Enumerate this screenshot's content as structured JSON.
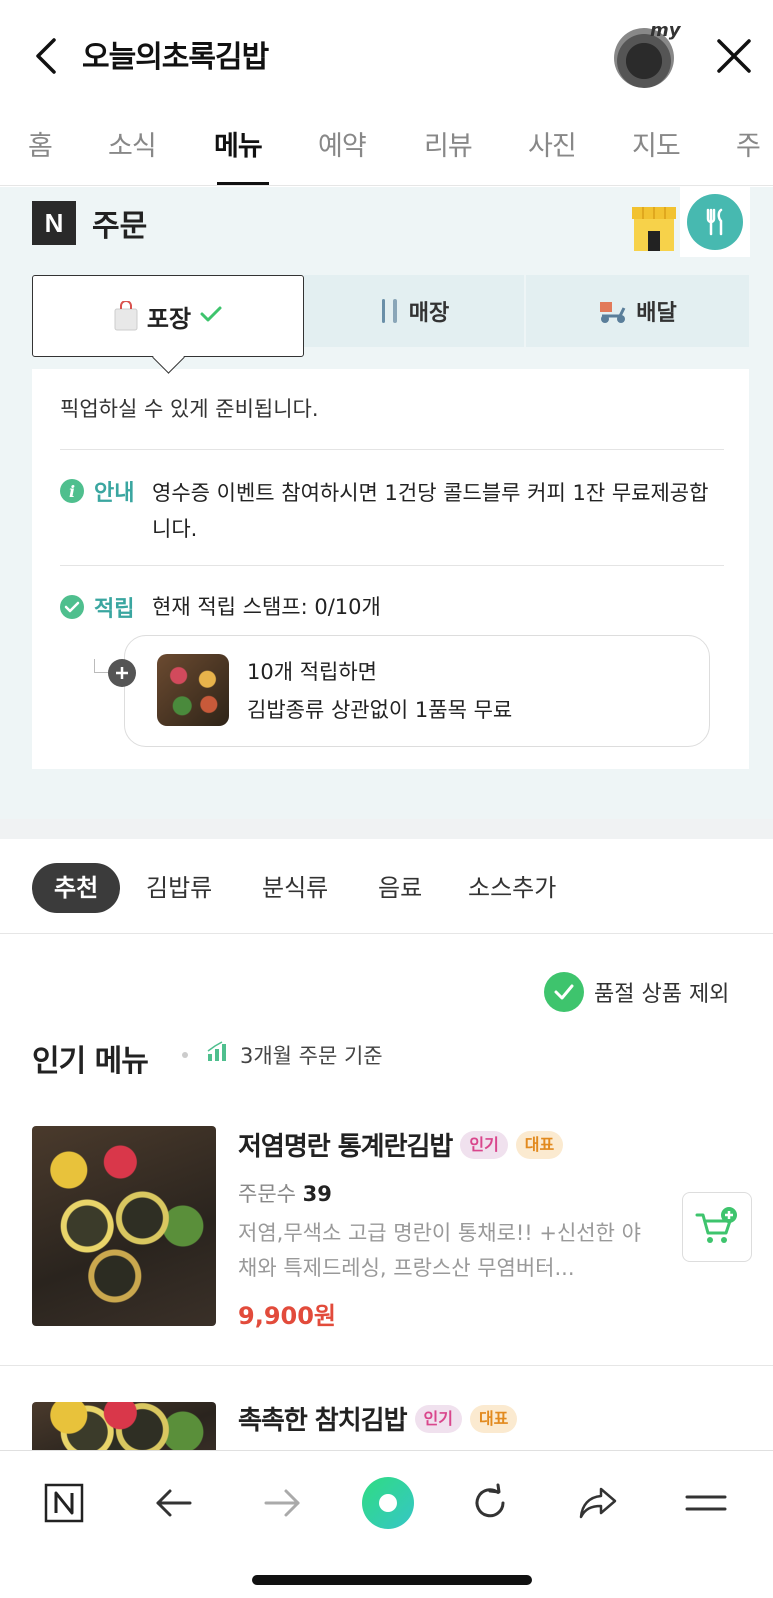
{
  "header": {
    "title": "오늘의초록김밥",
    "my_label": "my"
  },
  "tabs": [
    {
      "label": "홈"
    },
    {
      "label": "소식"
    },
    {
      "label": "메뉴"
    },
    {
      "label": "예약"
    },
    {
      "label": "리뷰"
    },
    {
      "label": "사진"
    },
    {
      "label": "지도"
    },
    {
      "label": "주"
    }
  ],
  "order": {
    "n_logo": "N",
    "title": "주문",
    "modes": {
      "pack": "포장",
      "store": "매장",
      "delivery": "배달"
    },
    "pickup_text": "픽업하실 수 있게 준비됩니다.",
    "notice_label": "안내",
    "notice_text": "영수증 이벤트 참여하시면 1건당 콜드블루 커피 1잔 무료제공합니다.",
    "stamp_label": "적립",
    "stamp_text": "현재 적립 스탬프: 0/10개",
    "reward_line1": "10개 적립하면",
    "reward_line2": "김밥종류 상관없이 1품목 무료"
  },
  "categories": [
    "추천",
    "김밥류",
    "분식류",
    "음료",
    "소스추가"
  ],
  "soldout_filter": "품절 상품 제외",
  "popular": {
    "title": "인기 메뉴",
    "subtitle": "3개월 주문 기준"
  },
  "menu_items": [
    {
      "name": "저염명란 통계란김밥",
      "badge_popular": "인기",
      "badge_rep": "대표",
      "order_count_label": "주문수",
      "order_count": "39",
      "description": "저염,무색소 고급 명란이 통채로!! +신선한 야채와 특제드레싱, 프랑스산 무염버터...",
      "price": "9,900원"
    },
    {
      "name": "촉촉한 참치김밥",
      "badge_popular": "인기",
      "badge_rep": "대표"
    }
  ],
  "colors": {
    "accent_teal": "#3aa6a0",
    "price_red": "#e24b3b",
    "check_green": "#3ec46d",
    "badge_pink": "#d9468c",
    "badge_orange": "#e28a1e"
  }
}
